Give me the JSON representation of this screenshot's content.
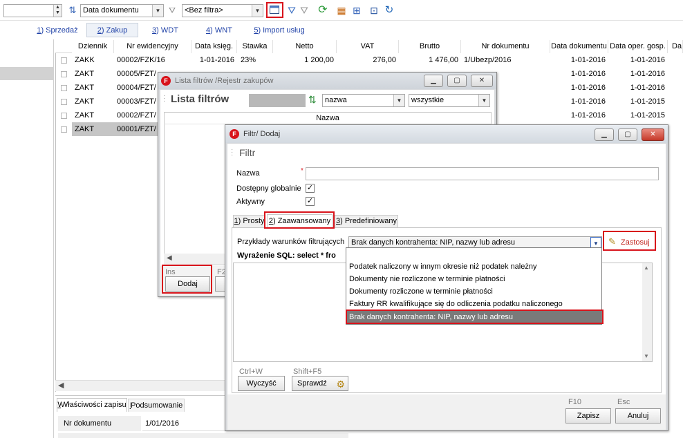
{
  "toolbar": {
    "sort_field": "Data dokumentu",
    "filter_value": "<Bez filtra>"
  },
  "tabs": [
    {
      "key": "1",
      "label": ") Sprzedaż"
    },
    {
      "key": "2",
      "label": ") Zakup"
    },
    {
      "key": "3",
      "label": ") WDT"
    },
    {
      "key": "4",
      "label": ") WNT"
    },
    {
      "key": "5",
      "label": ") Import usług"
    }
  ],
  "grid": {
    "headers": [
      "Dziennik",
      "Nr ewidencyjny",
      "Data księg.",
      "Stawka",
      "Netto",
      "VAT",
      "Brutto",
      "Nr dokumentu",
      "Data dokumentu",
      "Data oper. gosp.",
      "Da"
    ],
    "rows": [
      {
        "dziennik": "ZAKK",
        "nr": "00002/FZK/16",
        "ksieg": "1-01-2016",
        "stawka": "23%",
        "netto": "1 200,00",
        "vat": "276,00",
        "brutto": "1 476,00",
        "nrdok": "1/Ubezp/2016",
        "datadok": "1-01-2016",
        "dataop": "1-01-2016"
      },
      {
        "dziennik": "ZAKT",
        "nr": "00005/FZT/",
        "datadok": "1-01-2016",
        "dataop": "1-01-2016"
      },
      {
        "dziennik": "ZAKT",
        "nr": "00004/FZT/",
        "datadok": "1-01-2016",
        "dataop": "1-01-2016"
      },
      {
        "dziennik": "ZAKT",
        "nr": "00003/FZT/",
        "datadok": "1-01-2016",
        "dataop": "1-01-2015"
      },
      {
        "dziennik": "ZAKT",
        "nr": "00002/FZT/",
        "datadok": "1-01-2016",
        "dataop": "1-01-2015"
      },
      {
        "dziennik": "ZAKT",
        "nr": "00001/FZT/",
        "datadok": "1-01-2016",
        "dataop": "1-01-2015"
      }
    ]
  },
  "bottom": {
    "tab1": "Właściwości zapisu",
    "tab1_key": "W",
    "tab2": "Podsumowanie",
    "tab2_key": "P",
    "field_label": "Nr dokumentu",
    "field_value": "1/01/2016"
  },
  "lista": {
    "title": "Lista filtrów /Rejestr zakupów",
    "header": "Lista filtrów",
    "sort_by": "nazwa",
    "scope": "wszystkie",
    "col_name": "Nazwa",
    "ins_hint": "Ins",
    "f2_hint": "F2",
    "add_label": "Dodaj"
  },
  "filtr": {
    "title": "Filtr/ Dodaj",
    "header": "Filtr",
    "name_label": "Nazwa",
    "required_mark": "*",
    "global_label": "Dostępny globalnie",
    "active_label": "Aktywny",
    "tabs": [
      {
        "key": "1",
        "label": ") Prosty"
      },
      {
        "key": "2",
        "label": ") Zaawansowany"
      },
      {
        "key": "3",
        "label": ") Predefiniowany"
      }
    ],
    "examples_label": "Przykłady warunków filtrujących",
    "examples_selected": "Brak danych kontrahenta: NIP, nazwy lub adresu",
    "apply_label": "Zastosuj",
    "sql_label": "Wyrażenie SQL: select * fro",
    "options": [
      "Podatek naliczony w innym okresie niż podatek należny",
      "Dokumenty nie rozliczone w terminie płatności",
      "Dokumenty rozliczone w terminie płatności",
      "Faktury RR kwalifikujące się do odliczenia podatku naliczonego",
      "Brak danych kontrahenta: NIP, nazwy lub adresu"
    ],
    "clear_hint": "Ctrl+W",
    "clear_label": "Wyczyść",
    "check_hint": "Shift+F5",
    "check_label": "Sprawdź",
    "save_hint": "F10",
    "save_label": "Zapisz",
    "cancel_hint": "Esc",
    "cancel_label": "Anuluj"
  },
  "colors": {
    "accent_red": "#d8131b",
    "selected_row": "#c5c5c5",
    "dropdown_selected": "#7a7a7a"
  }
}
